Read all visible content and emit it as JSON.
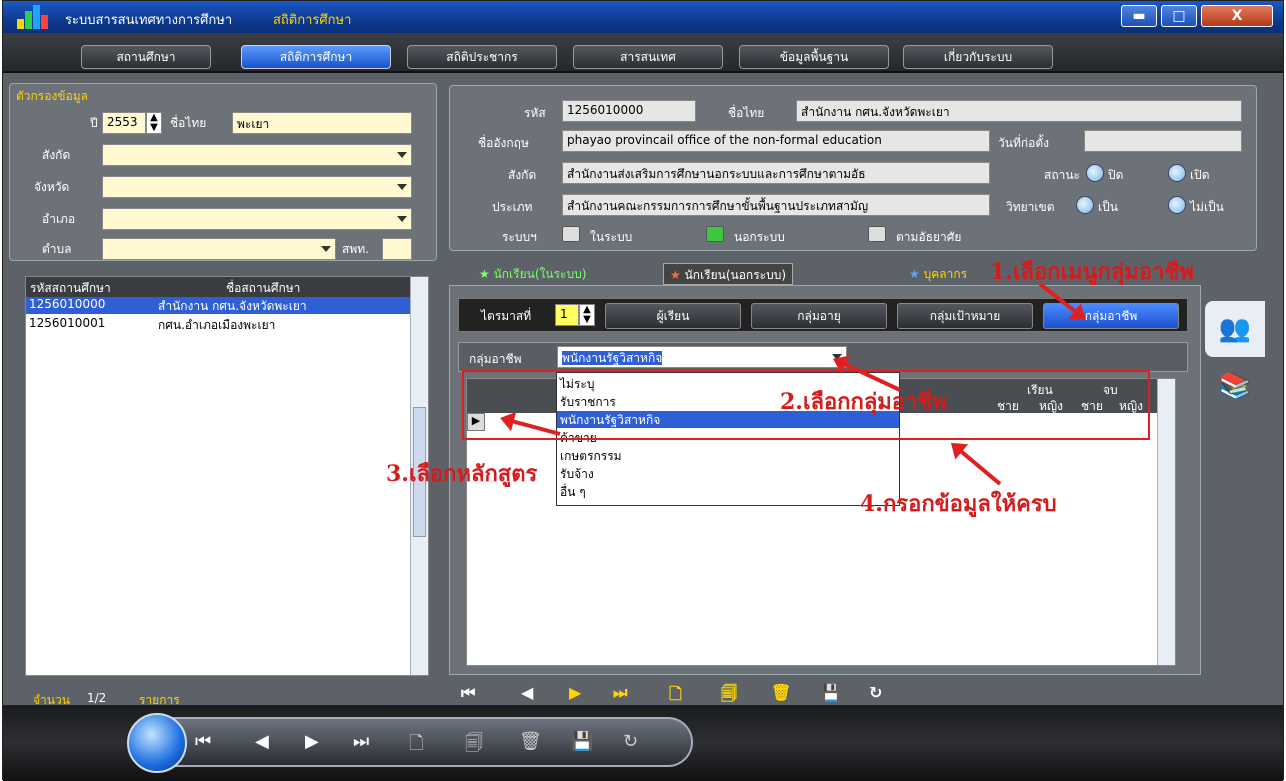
{
  "window": {
    "title": "ระบบสารสนเทศทางการศึกษา",
    "subtitle": "สถิติการศึกษา",
    "min": "▬",
    "max": "□",
    "close": "X"
  },
  "nav": [
    "สถานศึกษา",
    "สถิติการศึกษา",
    "สถิติประชากร",
    "สารสนเทศ",
    "ข้อมูลพื้นฐาน",
    "เกี่ยวกับระบบ"
  ],
  "filter": {
    "title": "ตัวกรองข้อมูล",
    "year_label": "ปี",
    "year": "2553",
    "thai_name_label": "ชื่อไทย",
    "thai_name": "พะเยา",
    "affil_label": "สังกัด",
    "province_label": "จังหวัด",
    "district_label": "อำเภอ",
    "subdistrict_label": "ตำบล",
    "spt_label": "สพท."
  },
  "school_list": {
    "col_code": "รหัสสถานศึกษา",
    "col_name": "ชื่อสถานศึกษา",
    "rows": [
      {
        "code": "1256010000",
        "name": "สำนักงาน กศน.จังหวัดพะเยา"
      },
      {
        "code": "1256010001",
        "name": "กศน.อำเภอเมืองพะเยา"
      }
    ],
    "count_label": "จำนวน",
    "count": "1/2",
    "items_label": "รายการ"
  },
  "detail": {
    "code_label": "รหัส",
    "code": "1256010000",
    "thai_label": "ชื่อไทย",
    "thai": "สำนักงาน กศน.จังหวัดพะเยา",
    "eng_label": "ชื่ออังกฤษ",
    "eng": "phayao provincail office of the non-formal education",
    "founded_label": "วันที่ก่อตั้ง",
    "affil_label": "สังกัด",
    "affil": "สำนักงานส่งเสริมการศึกษานอกระบบและการศึกษาตามอัธ",
    "status_label": "สถานะ",
    "closed": "ปิด",
    "open": "เปิด",
    "type_label": "ประเภท",
    "type": "สำนักงานคณะกรรมการการศึกษาขั้นพื้นฐานประเภทสามัญ",
    "campus_label": "วิทยาเขต",
    "yes": "เป็น",
    "no": "ไม่เป็น",
    "system_label": "ระบบฯ",
    "sys_in": "ในระบบ",
    "sys_out": "นอกระบบ",
    "sys_opt": "ตามอัธยาศัย"
  },
  "subtabs": [
    "นักเรียน(ในระบบ)",
    "นักเรียน(นอกระบบ)",
    "บุคลากร"
  ],
  "toolbar": {
    "quarter_label": "ไตรมาสที่",
    "quarter": "1",
    "buttons": [
      "ผู้เรียน",
      "กลุ่มอายุ",
      "กลุ่มเป้าหมาย",
      "กลุ่มอาชีพ"
    ]
  },
  "career": {
    "label": "กลุ่มอาชีพ",
    "value": "พนักงานรัฐวิสาหกิจ",
    "options": [
      "ไม่ระบุ",
      "รับราชการ",
      "พนักงานรัฐวิสาหกิจ",
      "ค้าขาย",
      "เกษตรกรรม",
      "รับจ้าง",
      "อื่น ๆ"
    ],
    "selected_index": 2
  },
  "grid": {
    "study": "เรียน",
    "graduate": "จบ",
    "male": "ชาย",
    "female": "หญิง"
  },
  "annotations": [
    "1.เลือกเมนูกลุ่มอาชีพ",
    "2.เลือกกลุ่มอาชีพ",
    "3.เลือกหลักสูตร",
    "4.กรอกข้อมูลให้ครบ"
  ],
  "nav_glyphs": [
    "⏮",
    "◀",
    "▶",
    "⏭",
    "🗋",
    "🗐",
    "🗑",
    "💾",
    "↻"
  ],
  "colors": {
    "accent": "#1f5bd6",
    "annotation": "#d51b1b",
    "yellow": "#ffd400",
    "green": "#7cff6a"
  }
}
